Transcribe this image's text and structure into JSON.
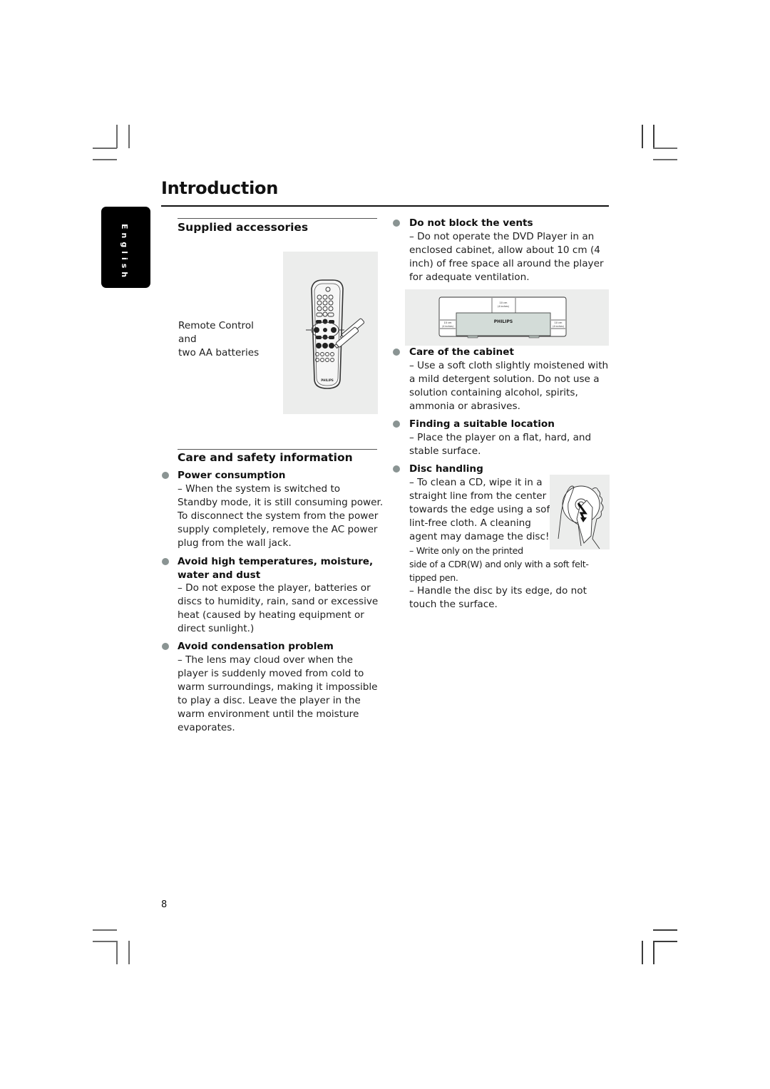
{
  "page": {
    "title": "Introduction",
    "language_tab": "English",
    "page_number": "8"
  },
  "supplied_accessories": {
    "heading": "Supplied accessories",
    "caption_lines": [
      "Remote Control",
      "and",
      "two AA batteries"
    ],
    "figure": {
      "remote_brand": "PHILIPS",
      "icon": "remote-control-with-batteries-illustration"
    }
  },
  "care_and_safety": {
    "heading": "Care and safety information",
    "items": [
      {
        "title": "Power consumption",
        "lines": [
          "–  When the system is switched to",
          "Standby mode, it is still consuming power.",
          "To disconnect the system from the power",
          "supply completely, remove the AC power",
          "plug from the wall jack."
        ]
      },
      {
        "title_lines": [
          "Avoid high temperatures, moisture,",
          "water and dust"
        ],
        "lines": [
          "–  Do not expose the player, batteries or",
          "discs to humidity, rain, sand or excessive",
          "heat (caused by heating equipment or",
          "direct sunlight.)"
        ]
      },
      {
        "title": "Avoid condensation problem",
        "lines": [
          "–  The lens may cloud over when the",
          "player is suddenly moved from cold to",
          "warm surroundings, making it impossible",
          "to play a disc. Leave the player in the",
          "warm environment until the moisture",
          "evaporates."
        ]
      }
    ]
  },
  "right_column": {
    "items": [
      {
        "title": "Do not block the vents",
        "lines": [
          "–  Do not operate the DVD Player in an",
          "enclosed cabinet,  allow about 10 cm (4",
          "inch) of free space all around the player",
          "for adequate ventilation."
        ]
      },
      {
        "title": "Care of the cabinet",
        "lines": [
          "–  Use a soft cloth slightly moistened with",
          "a mild detergent solution. Do not use a",
          "solution containing alcohol, spirits,",
          "ammonia or abrasives."
        ]
      },
      {
        "title": "Finding a suitable location",
        "lines": [
          "–  Place the player on a flat, hard, and",
          "stable surface."
        ]
      },
      {
        "title": "Disc handling",
        "lines": [
          "–  To clean a CD, wipe it in a",
          "straight line from the center",
          "towards the edge using a soft,",
          "lint-free cloth.  A cleaning",
          "agent may damage the disc!",
          "–  Write only on the printed",
          "side of a CDR(W) and only with a soft felt-",
          "tipped pen.",
          "–  Handle the disc by its edge, do not",
          "touch the surface."
        ]
      }
    ],
    "vent_figure": {
      "brand": "PHILIPS",
      "top_label": [
        "10 cm",
        "(4 inches)"
      ],
      "left_label": [
        "10 cm",
        "(4 inches)"
      ],
      "right_label": [
        "10 cm",
        "(4 inches)"
      ]
    },
    "disc_figure": {
      "icon": "hands-cleaning-disc-illustration"
    }
  }
}
